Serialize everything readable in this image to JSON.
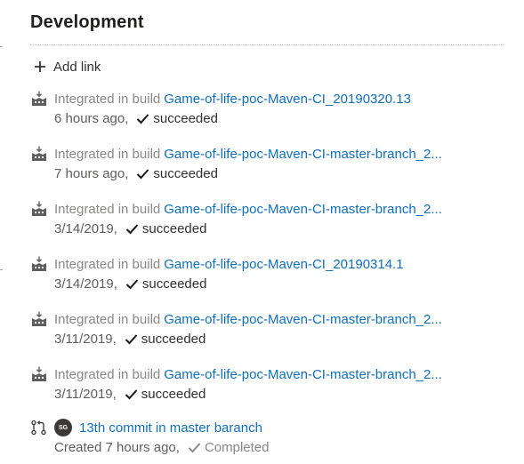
{
  "section": {
    "title": "Development",
    "add_link_label": "Add link"
  },
  "builds": [
    {
      "prefix": "Integrated in build",
      "link": "Game-of-life-poc-Maven-CI_20190320.13",
      "time": "6 hours ago,",
      "status": "succeeded"
    },
    {
      "prefix": "Integrated in build",
      "link": "Game-of-life-poc-Maven-CI-master-branch_2...",
      "time": "7 hours ago,",
      "status": "succeeded"
    },
    {
      "prefix": "Integrated in build",
      "link": "Game-of-life-poc-Maven-CI-master-branch_2...",
      "time": "3/14/2019,",
      "status": "succeeded"
    },
    {
      "prefix": "Integrated in build",
      "link": "Game-of-life-poc-Maven-CI_20190314.1",
      "time": "3/14/2019,",
      "status": "succeeded"
    },
    {
      "prefix": "Integrated in build",
      "link": "Game-of-life-poc-Maven-CI-master-branch_2...",
      "time": "3/11/2019,",
      "status": "succeeded"
    },
    {
      "prefix": "Integrated in build",
      "link": "Game-of-life-poc-Maven-CI-master-branch_2...",
      "time": "3/11/2019,",
      "status": "succeeded"
    }
  ],
  "pull_request": {
    "avatar_initials": "SG",
    "title": "13th commit in master baranch",
    "created": "Created 7 hours ago,",
    "status": "Completed"
  },
  "colors": {
    "link": "#106ebe",
    "success": "#107c10",
    "completed": "#8a8886"
  },
  "icons": {
    "add": "plus-icon",
    "build": "build-pipeline-icon",
    "status": "checkmark-icon",
    "pr": "pull-request-icon"
  }
}
